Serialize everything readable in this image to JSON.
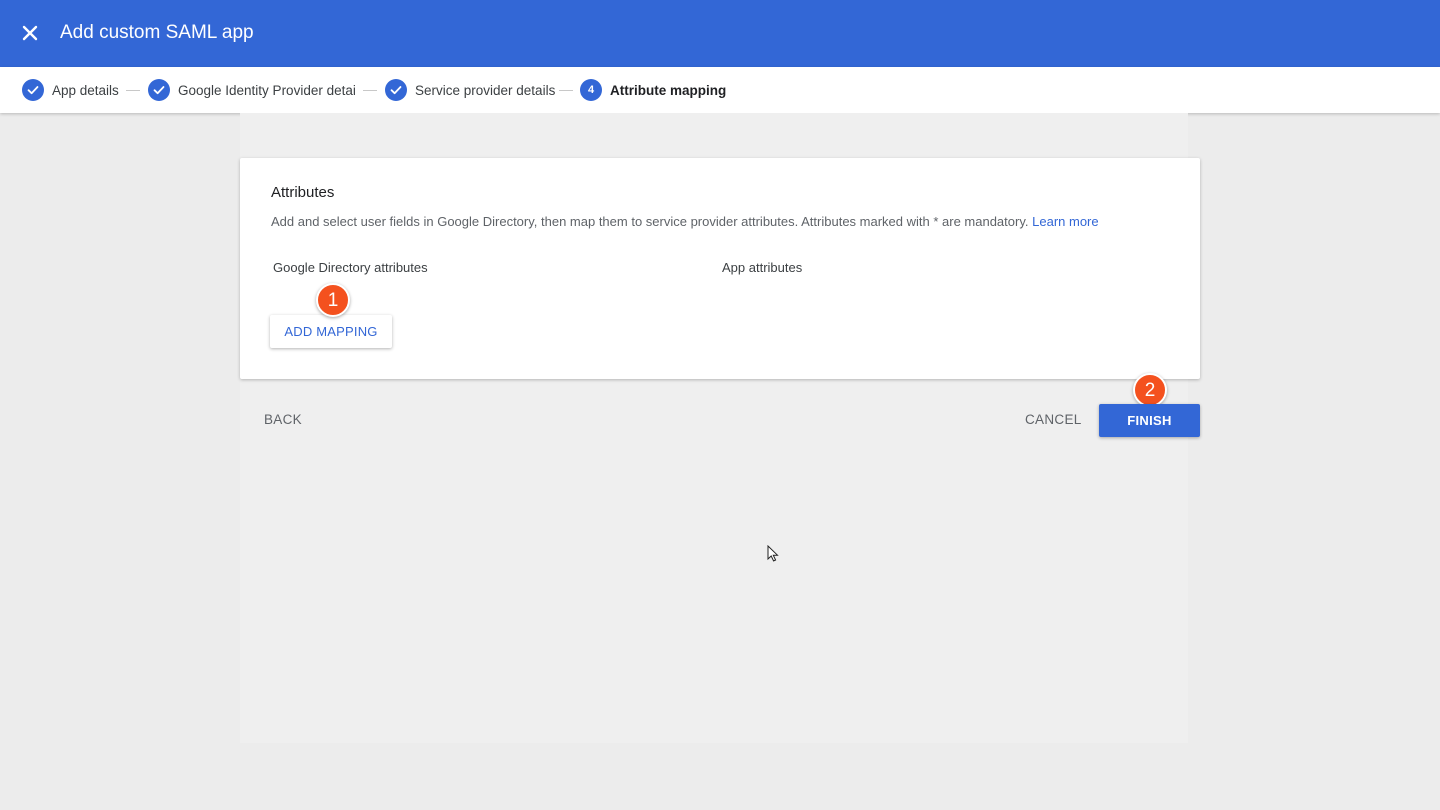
{
  "header": {
    "title": "Add custom SAML app",
    "close_icon": "close-icon",
    "background_color": "#3367d6"
  },
  "stepper": {
    "steps": [
      {
        "label": "App details",
        "state": "done",
        "icon": "check-icon"
      },
      {
        "label": "Google Identity Provider detail:",
        "state": "done",
        "icon": "check-icon"
      },
      {
        "label": "Service provider details",
        "state": "done",
        "icon": "check-icon"
      },
      {
        "label": "Attribute mapping",
        "state": "active",
        "number": "4"
      }
    ]
  },
  "card": {
    "title": "Attributes",
    "description": "Add and select user fields in Google Directory, then map them to service provider attributes. Attributes marked with * are mandatory.",
    "learn_more": "Learn more",
    "col_directory": "Google Directory attributes",
    "col_app": "App attributes",
    "add_mapping": "ADD MAPPING"
  },
  "footer": {
    "back": "BACK",
    "cancel": "CANCEL",
    "finish": "FINISH"
  },
  "callouts": {
    "first": "1",
    "second": "2",
    "color": "#f4511e"
  }
}
